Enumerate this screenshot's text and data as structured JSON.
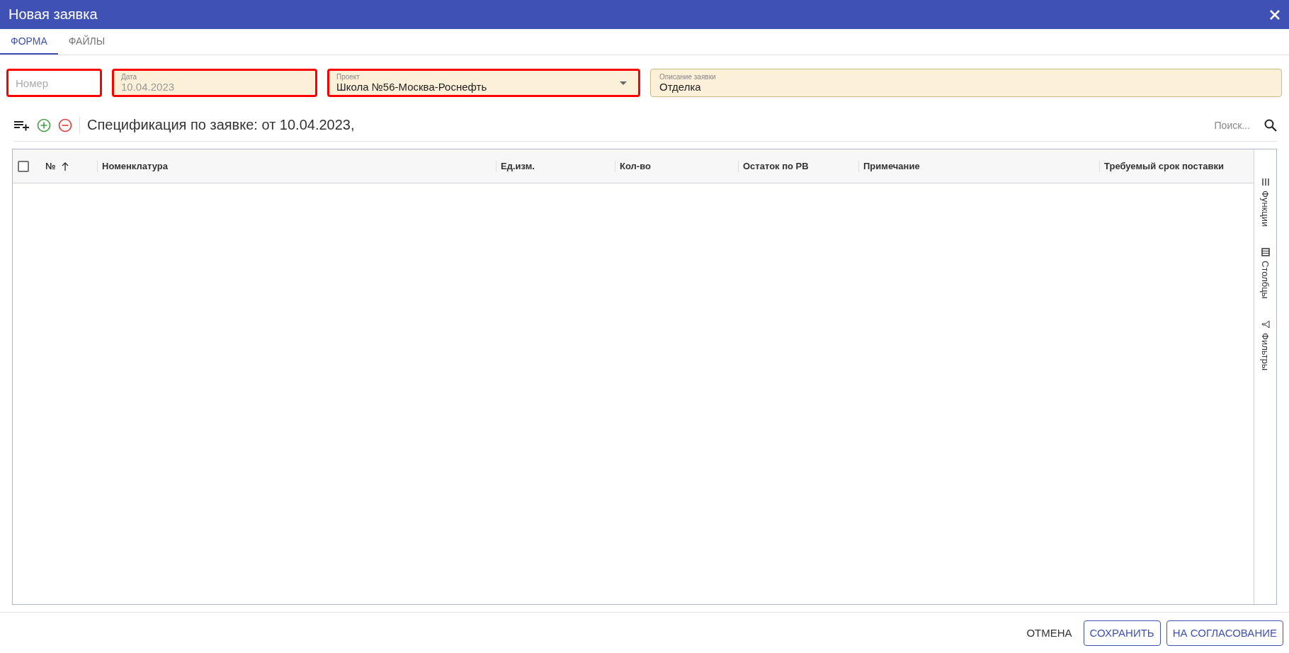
{
  "window": {
    "title": "Новая заявка"
  },
  "tabs": [
    {
      "label": "ФОРМА",
      "selected": true
    },
    {
      "label": "ФАЙЛЫ",
      "selected": false
    }
  ],
  "fields": [
    {
      "kind": "text",
      "placeholder": "Номер",
      "error": true,
      "filled": false
    },
    {
      "kind": "text",
      "label": "Дата",
      "value": "10.04.2023",
      "error": true,
      "filled": true,
      "disabled": true
    },
    {
      "kind": "select",
      "label": "Проект",
      "value": "Школа №56-Москва-Роснефть",
      "error": true,
      "filled": true,
      "disabled": false
    },
    {
      "kind": "text",
      "label": "Описание заявки",
      "value": "Отделка",
      "error": false,
      "filled": true,
      "disabled": false
    }
  ],
  "spec": {
    "title": "Спецификация по заявке: от 10.04.2023,",
    "search": {
      "placeholder": "Поиск..."
    }
  },
  "table": {
    "select_all": {
      "checked": false
    },
    "columns": [
      {
        "label": "№",
        "sorted": true
      },
      {
        "label": "Номенклатура",
        "sorted": false
      },
      {
        "label": "Ед.изм.",
        "sorted": false
      },
      {
        "label": "Кол-во",
        "sorted": false
      },
      {
        "label": "Остаток по РВ",
        "sorted": false
      },
      {
        "label": "Примечание",
        "sorted": false
      },
      {
        "label": "Требуемый срок поставки",
        "sorted": false
      }
    ]
  },
  "side_panel": [
    {
      "kind": "functions",
      "label": "Функции"
    },
    {
      "kind": "columns",
      "label": "Столбцы"
    },
    {
      "kind": "filters",
      "label": "Фильтры"
    }
  ],
  "buttons": [
    {
      "kind": "text",
      "label": "ОТМЕНА"
    },
    {
      "kind": "outlined",
      "label": "СОХРАНИТЬ"
    },
    {
      "kind": "outlined",
      "label": "НА СОГЛАСОВАНИЕ"
    }
  ]
}
